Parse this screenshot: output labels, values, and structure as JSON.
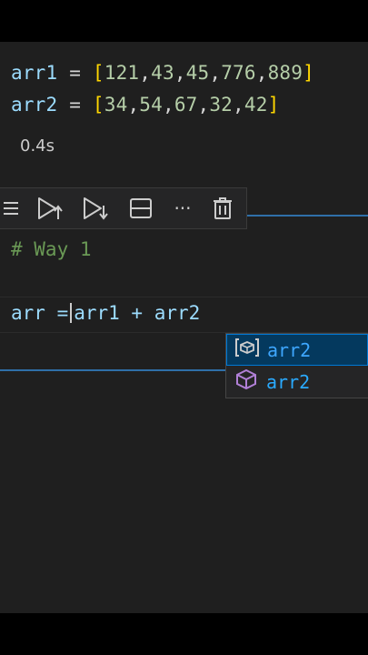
{
  "cell1": {
    "line1": {
      "var": "arr1",
      "op": " = ",
      "open": "[",
      "close": "]",
      "values": [
        "121",
        "43",
        "45",
        "776",
        "889"
      ]
    },
    "line2": {
      "var": "arr2",
      "op": " = ",
      "open": "[",
      "close": "]",
      "values": [
        "34",
        "54",
        "67",
        "32",
        "42"
      ]
    },
    "exec_time": "0.4s"
  },
  "toolbar": {
    "icons": [
      "list-icon",
      "run-above-icon",
      "run-below-icon",
      "split-cell-icon",
      "more-icon",
      "delete-icon"
    ],
    "more_glyph": "···"
  },
  "cell2": {
    "comment": "# Way 1",
    "line_left": "arr =",
    "line_right": "arr1 + arr2"
  },
  "suggestions": [
    {
      "icon": "variable-icon",
      "label": "arr2",
      "selected": true
    },
    {
      "icon": "cube-icon",
      "label": "arr2",
      "selected": false
    }
  ],
  "colors": {
    "editor_bg": "#1f1f1f",
    "variable": "#9cdcfe",
    "number": "#b5cea8",
    "bracket": "#ffd700",
    "comment": "#6a9955",
    "suggest_selected": "#04395e",
    "accent": "#0078d4"
  }
}
